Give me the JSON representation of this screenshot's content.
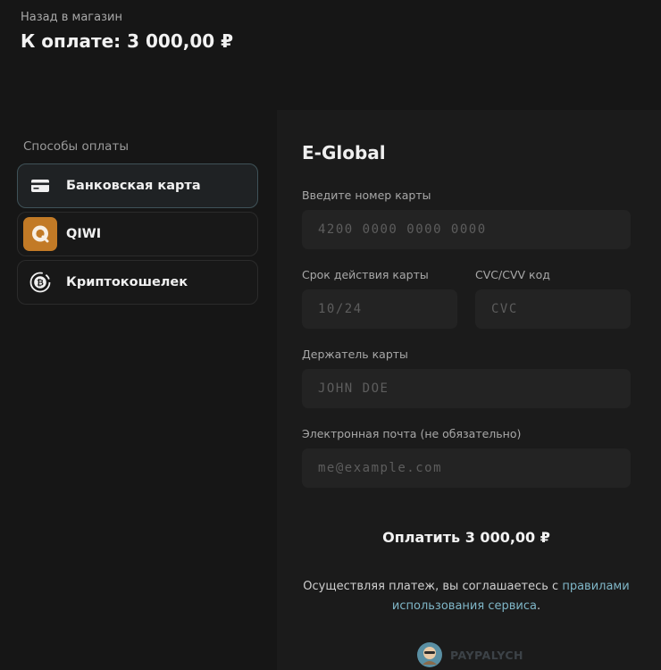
{
  "header": {
    "back_link": "Назад в магазин",
    "amount_title": "К оплате: 3 000,00 ₽"
  },
  "sidebar": {
    "heading": "Способы оплаты",
    "methods": [
      {
        "label": "Банковская карта",
        "icon": "credit-card-icon",
        "active": true
      },
      {
        "label": "QIWI",
        "icon": "qiwi-logo-icon",
        "active": false
      },
      {
        "label": "Криптокошелек",
        "icon": "bitcoin-icon",
        "active": false
      }
    ]
  },
  "form": {
    "gateway_title": "E-Global",
    "card_number": {
      "label": "Введите номер карты",
      "placeholder": "4200 0000 0000 0000",
      "value": ""
    },
    "expiry": {
      "label": "Срок действия карты",
      "placeholder": "10/24",
      "value": ""
    },
    "cvc": {
      "label": "CVC/CVV код",
      "placeholder": "CVC",
      "value": ""
    },
    "holder": {
      "label": "Держатель карты",
      "placeholder": "JOHN DOE",
      "value": ""
    },
    "email": {
      "label": "Электронная почта (не обязательно)",
      "placeholder": "me@example.com",
      "value": ""
    },
    "pay_button": "Оплатить 3 000,00 ₽",
    "terms_prefix": "Осуществляя платеж, вы соглашаетесь с ",
    "terms_link": "правилами использования сервиса",
    "terms_suffix": "."
  },
  "footer": {
    "brand_name": "PAYPALYCH"
  },
  "colors": {
    "background": "#161616",
    "panel": "#1b1b1b",
    "input_bg": "#232323",
    "link": "#7fb6c7",
    "qiwi_orange": "#c27a26",
    "active_border": "#3f5258"
  }
}
